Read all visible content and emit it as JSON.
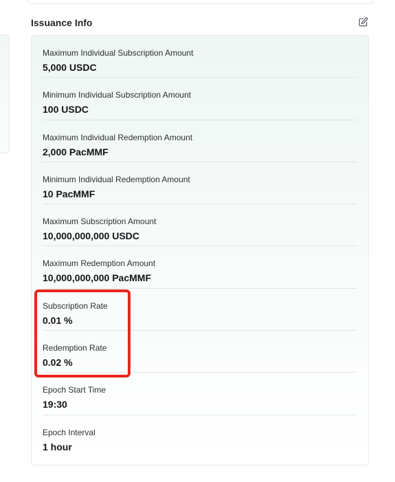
{
  "section": {
    "title": "Issuance Info",
    "edit_icon": "edit-icon"
  },
  "rows": [
    {
      "label": "Maximum Individual Subscription Amount",
      "value": "5,000 USDC"
    },
    {
      "label": "Minimum Individual Subscription Amount",
      "value": "100 USDC"
    },
    {
      "label": "Maximum Individual Redemption Amount",
      "value": "2,000 PacMMF"
    },
    {
      "label": "Minimum Individual Redemption Amount",
      "value": "10 PacMMF"
    },
    {
      "label": "Maximum Subscription Amount",
      "value": "10,000,000,000 USDC"
    },
    {
      "label": "Maximum Redemption Amount",
      "value": "10,000,000,000 PacMMF"
    },
    {
      "label": "Subscription Rate",
      "value": "0.01 %"
    },
    {
      "label": "Redemption Rate",
      "value": "0.02 %"
    },
    {
      "label": "Epoch Start Time",
      "value": "19:30"
    },
    {
      "label": "Epoch Interval",
      "value": "1 hour"
    }
  ],
  "colors": {
    "highlight": "#e8251f",
    "card_gradient_top": "#eef6f3"
  }
}
